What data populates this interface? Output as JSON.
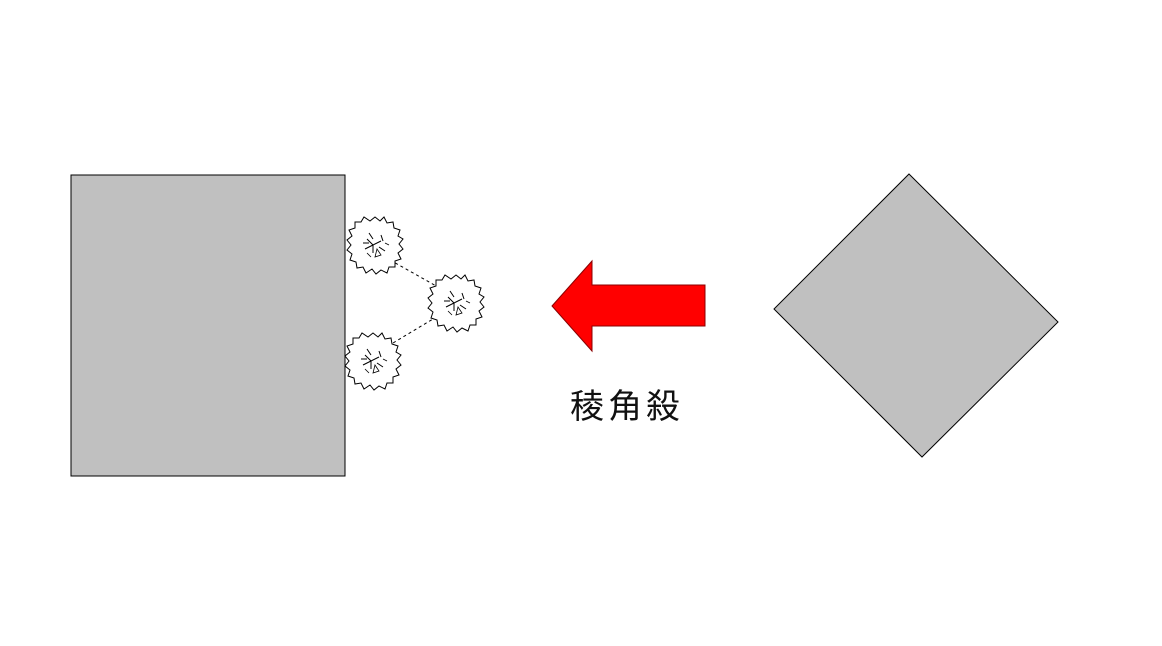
{
  "caption": "稜角殺",
  "colors": {
    "building_fill": "#c0c0c0",
    "outline": "#000000",
    "arrow": "#ff0000",
    "background": "#ffffff"
  },
  "elements": {
    "left_shape": "square-building",
    "right_shape": "diamond-building",
    "arrow_direction": "left",
    "tree_count": 3,
    "tree_icon": "shrub-icon"
  }
}
